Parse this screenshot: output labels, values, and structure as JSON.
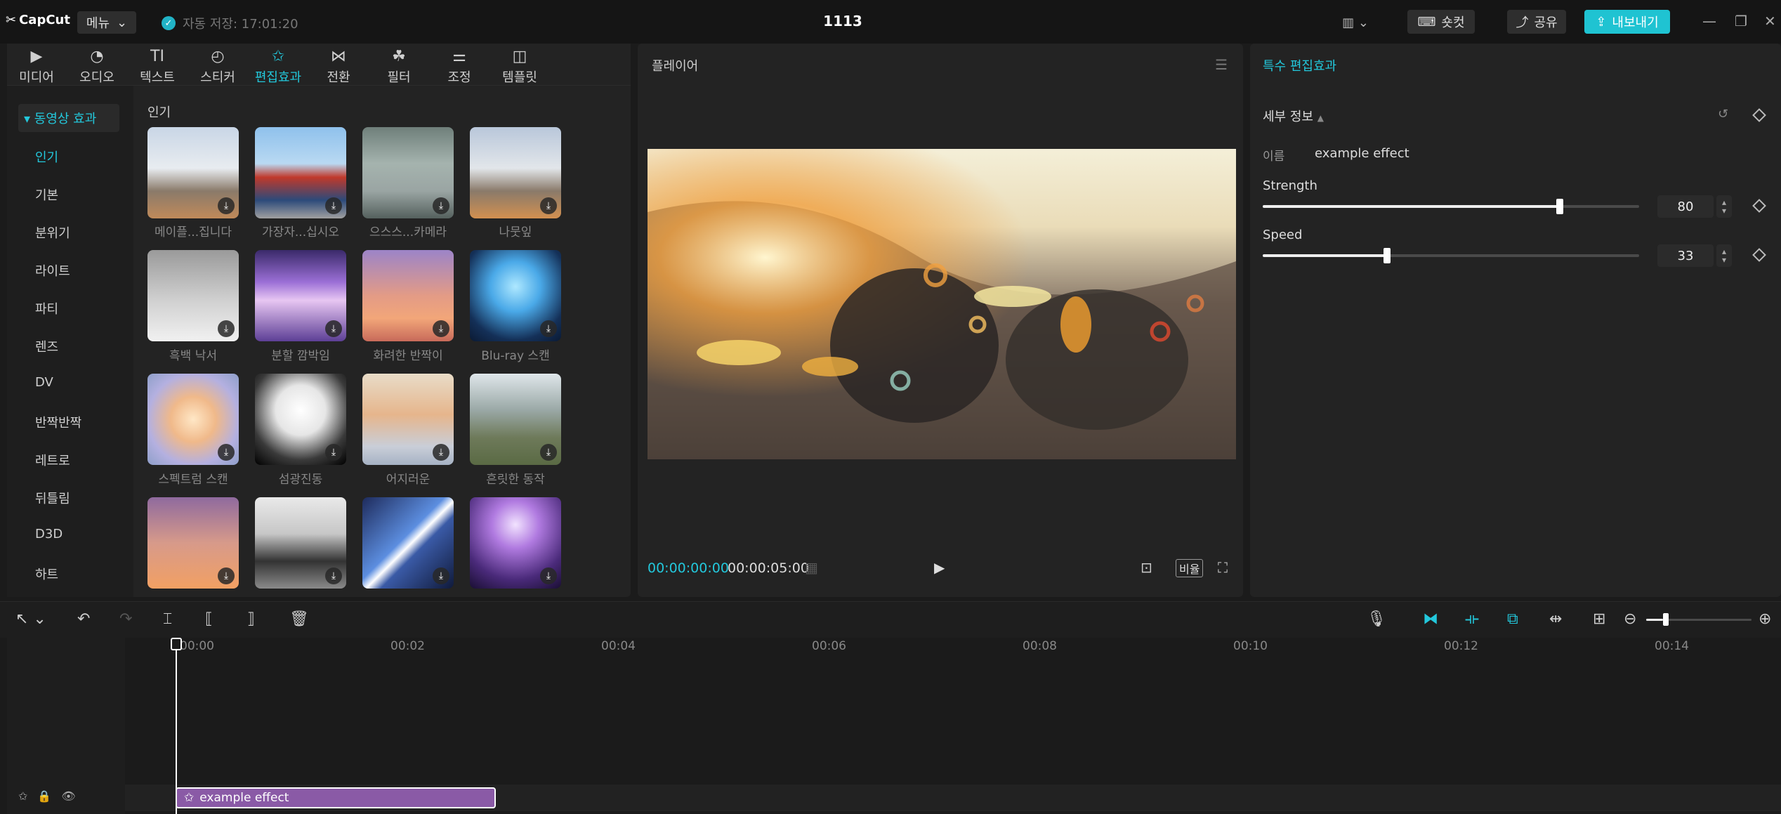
{
  "app": {
    "logo": "CapCut",
    "menu": "메뉴",
    "autosave": "자동 저장: 17:01:20",
    "project_title": "1113"
  },
  "topbar_right": {
    "shortcuts": "숏컷",
    "share": "공유",
    "export": "내보내기"
  },
  "media_tabs": [
    {
      "label": "미디어",
      "icon": "media-icon"
    },
    {
      "label": "오디오",
      "icon": "audio-icon"
    },
    {
      "label": "텍스트",
      "icon": "text-icon"
    },
    {
      "label": "스티커",
      "icon": "sticker-icon"
    },
    {
      "label": "편집효과",
      "icon": "effects-icon",
      "active": true
    },
    {
      "label": "전환",
      "icon": "transition-icon"
    },
    {
      "label": "필터",
      "icon": "filter-icon"
    },
    {
      "label": "조정",
      "icon": "adjust-icon"
    },
    {
      "label": "템플릿",
      "icon": "template-icon"
    }
  ],
  "categories": {
    "header": "▾ 동영상 효과",
    "items": [
      "인기",
      "기본",
      "분위기",
      "라이트",
      "파티",
      "렌즈",
      "DV",
      "반짝반짝",
      "레트로",
      "뒤틀림",
      "D3D",
      "하트"
    ],
    "active": "인기"
  },
  "section_title": "인기",
  "effects": [
    {
      "label": "메이플...집니다"
    },
    {
      "label": "가장자...십시오"
    },
    {
      "label": "으스스...카메라"
    },
    {
      "label": "나뭇잎"
    },
    {
      "label": "흑백 낙서"
    },
    {
      "label": "분할 깜박임"
    },
    {
      "label": "화려한 반짝이"
    },
    {
      "label": "Blu-ray 스캔"
    },
    {
      "label": "스펙트럼 스캔"
    },
    {
      "label": "섬광진동"
    },
    {
      "label": "어지러운"
    },
    {
      "label": "흔릿한 동작"
    },
    {
      "label": ""
    },
    {
      "label": ""
    },
    {
      "label": ""
    },
    {
      "label": ""
    }
  ],
  "player": {
    "title": "플레이어",
    "current_time": "00:00:00:00",
    "duration": "00:00:05:00",
    "ratio": "비율"
  },
  "details": {
    "panel_title": "특수 편집효과",
    "section": "세부 정보",
    "name_label": "이름",
    "name_value": "example effect",
    "strength_label": "Strength",
    "strength_value": "80",
    "strength_level": 0.79,
    "speed_label": "Speed",
    "speed_value": "33",
    "speed_level": 0.33
  },
  "timeline": {
    "ticks": [
      "00:00",
      "00:02",
      "00:04",
      "00:06",
      "00:08",
      "00:10",
      "00:12",
      "00:14"
    ],
    "clip_label": "example effect"
  },
  "colors": {
    "accent": "#23c8dc",
    "clip": "#8a5aa6",
    "panel": "#232323"
  }
}
